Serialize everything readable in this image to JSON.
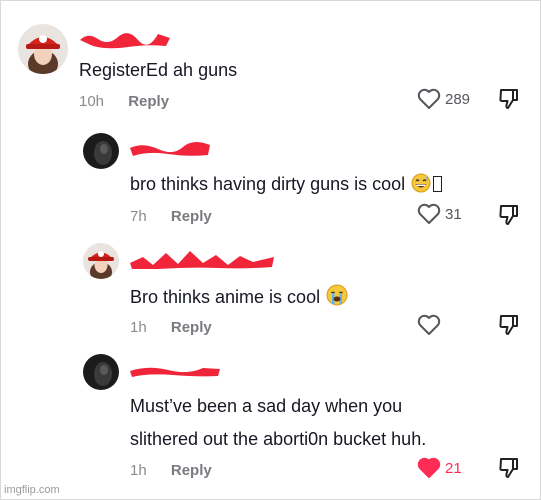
{
  "comments": [
    {
      "text": "RegisterEd ah guns",
      "time": "10h",
      "reply_label": "Reply",
      "likes": "289",
      "liked": false
    },
    {
      "text": "bro thinks having dirty guns is cool",
      "time": "7h",
      "reply_label": "Reply",
      "likes": "31",
      "liked": false,
      "emoji": "grinning-sweat-emoji"
    },
    {
      "text": "Bro thinks anime is cool",
      "time": "1h",
      "reply_label": "Reply",
      "likes": "",
      "liked": false,
      "emoji": "crying-emoji"
    },
    {
      "text_line1": "Must’ve been a sad day when you",
      "text_line2": "slithered out the aborti0n bucket huh.",
      "time": "1h",
      "reply_label": "Reply",
      "likes": "21",
      "liked": true
    }
  ],
  "colors": {
    "redaction": "#f0253a",
    "like_active": "#fe2c55",
    "meta_gray": "#8a8b91"
  },
  "watermark": "imgflip.com"
}
